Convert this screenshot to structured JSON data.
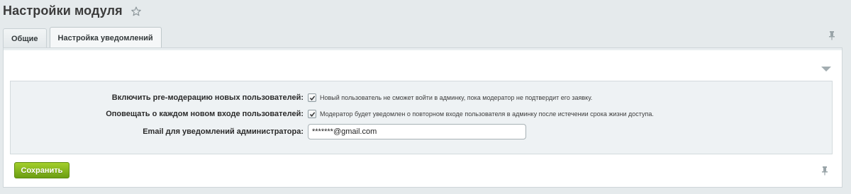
{
  "header": {
    "title": "Настройки модуля",
    "favorite_icon": "star-icon"
  },
  "tabs": [
    {
      "label": "Общие",
      "active": false
    },
    {
      "label": "Настройка уведомлений",
      "active": true
    }
  ],
  "form": {
    "rows": [
      {
        "label": "Включить pre-модерацию новых пользователей:",
        "checked": true,
        "note": "Новый пользователь не сможет войти в админку, пока модератор не подтвердит его заявку."
      },
      {
        "label": "Оповещать о каждом новом входе пользователей:",
        "checked": true,
        "note": "Модератор будет уведомлен о повторном входе пользователя в админку после истечении срока жизни доступа."
      }
    ],
    "email": {
      "label": "Email для уведомлений администратора:",
      "value": "*******@gmail.com"
    }
  },
  "actions": {
    "save_label": "Сохранить"
  },
  "colors": {
    "save_button": "#7fb31a",
    "background": "#e5eaec",
    "settings_box": "#eef2f4"
  }
}
